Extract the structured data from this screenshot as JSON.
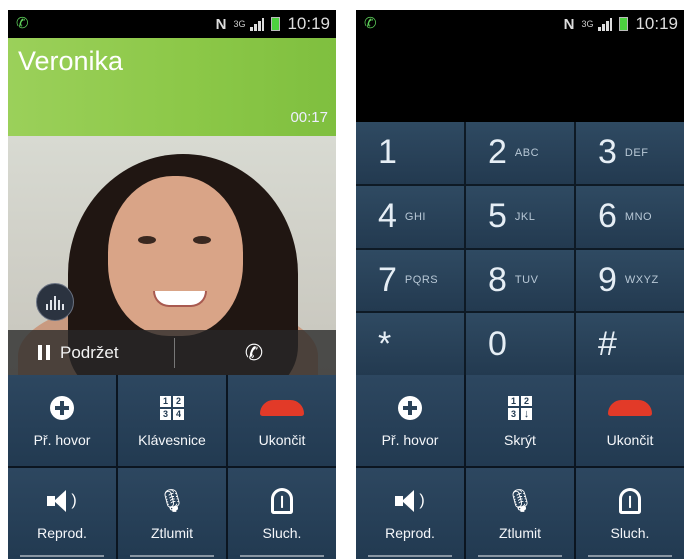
{
  "status_bar": {
    "time": "10:19",
    "nfc_label": "N",
    "network_label": "3G",
    "icons": [
      "phone-icon",
      "nfc-icon",
      "network-icon",
      "signal-icon",
      "battery-icon"
    ]
  },
  "call_screen": {
    "caller_name": "Veronika",
    "call_duration": "00:17",
    "hold_label": "Podržet"
  },
  "keypad": {
    "keys": [
      {
        "num": "1",
        "letters": ""
      },
      {
        "num": "2",
        "letters": "ABC"
      },
      {
        "num": "3",
        "letters": "DEF"
      },
      {
        "num": "4",
        "letters": "GHI"
      },
      {
        "num": "5",
        "letters": "JKL"
      },
      {
        "num": "6",
        "letters": "MNO"
      },
      {
        "num": "7",
        "letters": "PQRS"
      },
      {
        "num": "8",
        "letters": "TUV"
      },
      {
        "num": "9",
        "letters": "WXYZ"
      },
      {
        "num": "*",
        "letters": ""
      },
      {
        "num": "0",
        "letters": ""
      },
      {
        "num": "#",
        "letters": ""
      }
    ]
  },
  "left_controls": {
    "add_call": "Př. hovor",
    "keypad": "Klávesnice",
    "end_call": "Ukončit",
    "speaker": "Reprod.",
    "mute": "Ztlumit",
    "headset": "Sluch."
  },
  "right_controls": {
    "add_call": "Př. hovor",
    "hide": "Skrýt",
    "end_call": "Ukončit",
    "speaker": "Reprod.",
    "mute": "Ztlumit",
    "headset": "Sluch."
  },
  "keypad_icon_digits": [
    "1",
    "2",
    "3",
    "4"
  ],
  "colors": {
    "caller_banner": "#8cc848",
    "button_bg": "#2d4760",
    "end_call_red": "#e23a28",
    "status_phone_green": "#5fd35b"
  }
}
